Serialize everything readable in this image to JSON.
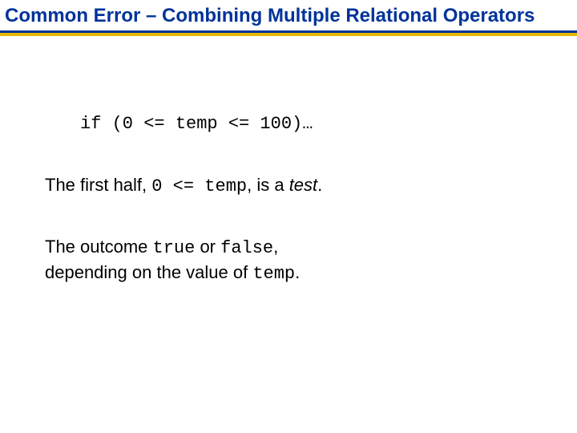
{
  "title": "Common Error –  Combining Multiple Relational Operators",
  "code_line": "if (0 <= temp <= 100)…",
  "p1": {
    "a": "The first half, ",
    "b": "0 <= temp",
    "c": ", is a ",
    "d": "test",
    "e": "."
  },
  "p2": {
    "a": "The outcome ",
    "b": "true",
    "c": " or ",
    "d": "false",
    "e": ",",
    "f": "depending on the value of ",
    "g": "temp",
    "h": "."
  }
}
